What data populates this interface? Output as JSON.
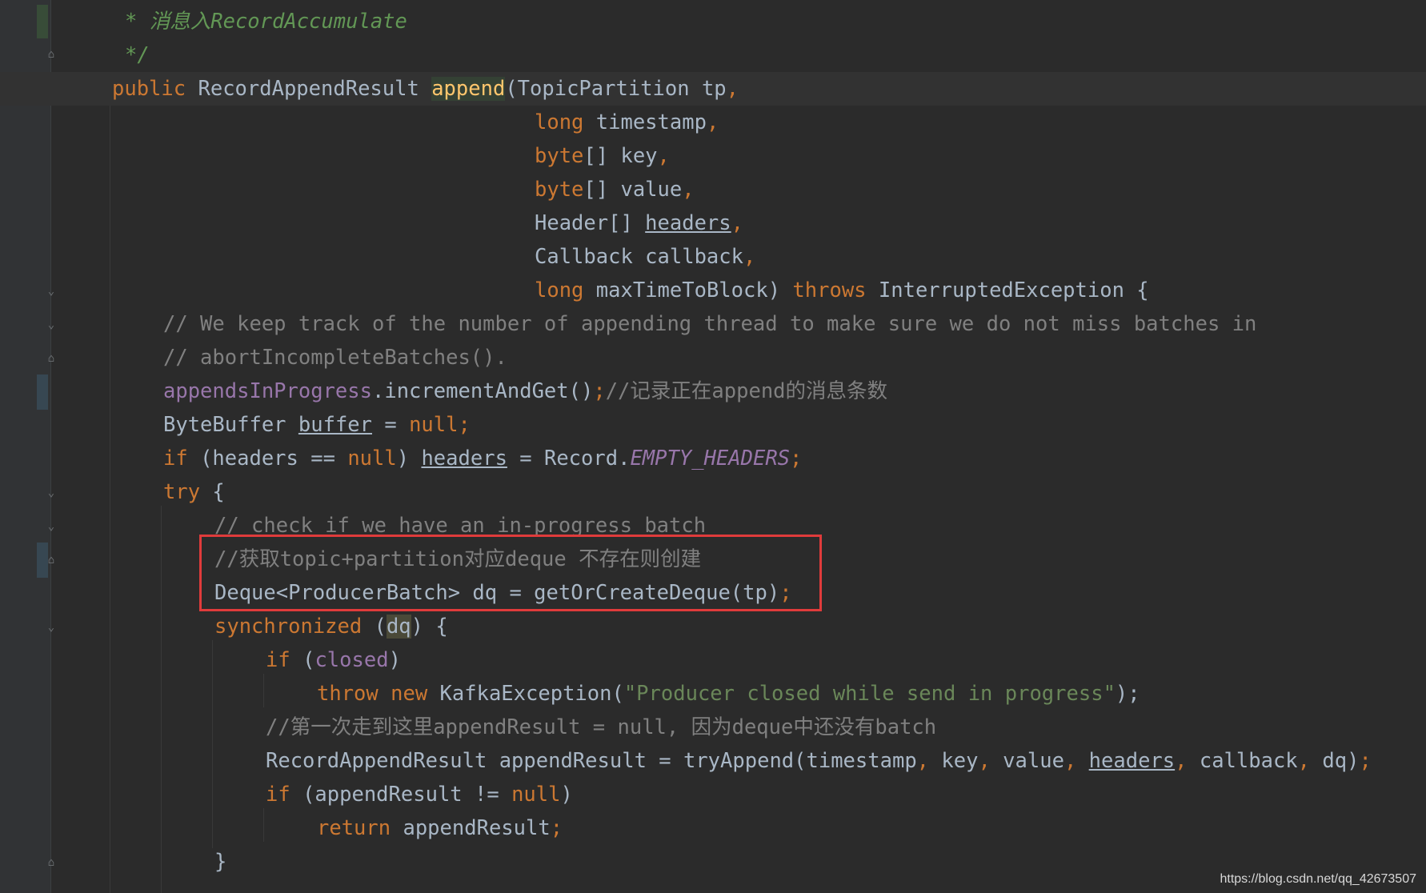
{
  "gutter": {
    "at_marker": "@"
  },
  "code": {
    "l01": {
      "star": "* ",
      "cn": "消息入",
      "ref": "RecordAccumulate"
    },
    "l02": {
      "end": "*/"
    },
    "l03": {
      "public": "public",
      "type": "RecordAppendResult",
      "method": "append",
      "args": "(TopicPartition tp",
      "comma": ","
    },
    "l04": {
      "kw": "long",
      "rest": " timestamp",
      "comma": ","
    },
    "l05": {
      "kw": "byte",
      "rest": "[] key",
      "comma": ","
    },
    "l06": {
      "kw": "byte",
      "rest": "[] value",
      "comma": ","
    },
    "l07": {
      "type": "Header[] ",
      "var": "headers",
      "comma": ","
    },
    "l08": {
      "text": "Callback callback",
      "comma": ","
    },
    "l09": {
      "kw": "long",
      "rest": " maxTimeToBlock) ",
      "throws": "throws",
      "exc": " InterruptedException {"
    },
    "l10": {
      "comment": "// We keep track of the number of appending thread to make sure we do not miss batches in"
    },
    "l11": {
      "comment": "// abortIncompleteBatches()."
    },
    "l12": {
      "field": "appendsInProgress",
      "call": ".incrementAndGet()",
      "semi": ";",
      "comment": "//记录正在append的消息条数"
    },
    "l13": {
      "type": "ByteBuffer ",
      "var": "buffer",
      "eq": " = ",
      "null": "null",
      "semi": ";"
    },
    "l14": {
      "if": "if",
      "cond1": " (headers == ",
      "null": "null",
      "cond2": ") ",
      "var": "headers",
      "eq": " = Record.",
      "const": "EMPTY_HEADERS",
      "semi": ";"
    },
    "l15": {
      "try": "try",
      "brace": " {"
    },
    "l16": {
      "comment": "// check if we have an in-progress batch"
    },
    "l17": {
      "comment": "//获取topic+partition对应deque 不存在则创建"
    },
    "l18": {
      "code": "Deque<ProducerBatch> dq = getOrCreateDeque(tp)",
      "semi": ";"
    },
    "l19": {
      "sync": "synchronized",
      "open": " (",
      "dq": "dq",
      "close": ") {"
    },
    "l20": {
      "if": "if",
      "open": " (",
      "field": "closed",
      "close": ")"
    },
    "l21": {
      "throw": "throw",
      "new": " new",
      "cls": " KafkaException(",
      "str": "\"Producer closed while send in progress\"",
      "end": ");"
    },
    "l22": {
      "comment": "//第一次走到这里appendResult = null, 因为deque中还没有batch"
    },
    "l23": {
      "a": "RecordAppendResult appendResult = tryAppend(timestamp",
      "c1": ",",
      "b": " key",
      "c2": ",",
      "c": " value",
      "c3": ",",
      "sp": " ",
      "var": "headers",
      "c4": ",",
      "d": " callback",
      "c5": ",",
      "e": " dq)",
      "semi": ";"
    },
    "l24": {
      "if": "if",
      "cond": " (appendResult != ",
      "null": "null",
      "close": ")"
    },
    "l25": {
      "ret": "return",
      "rest": " appendResult",
      "semi": ";"
    },
    "l26": {
      "brace": "}"
    }
  },
  "watermark": "https://blog.csdn.net/qq_42673507"
}
